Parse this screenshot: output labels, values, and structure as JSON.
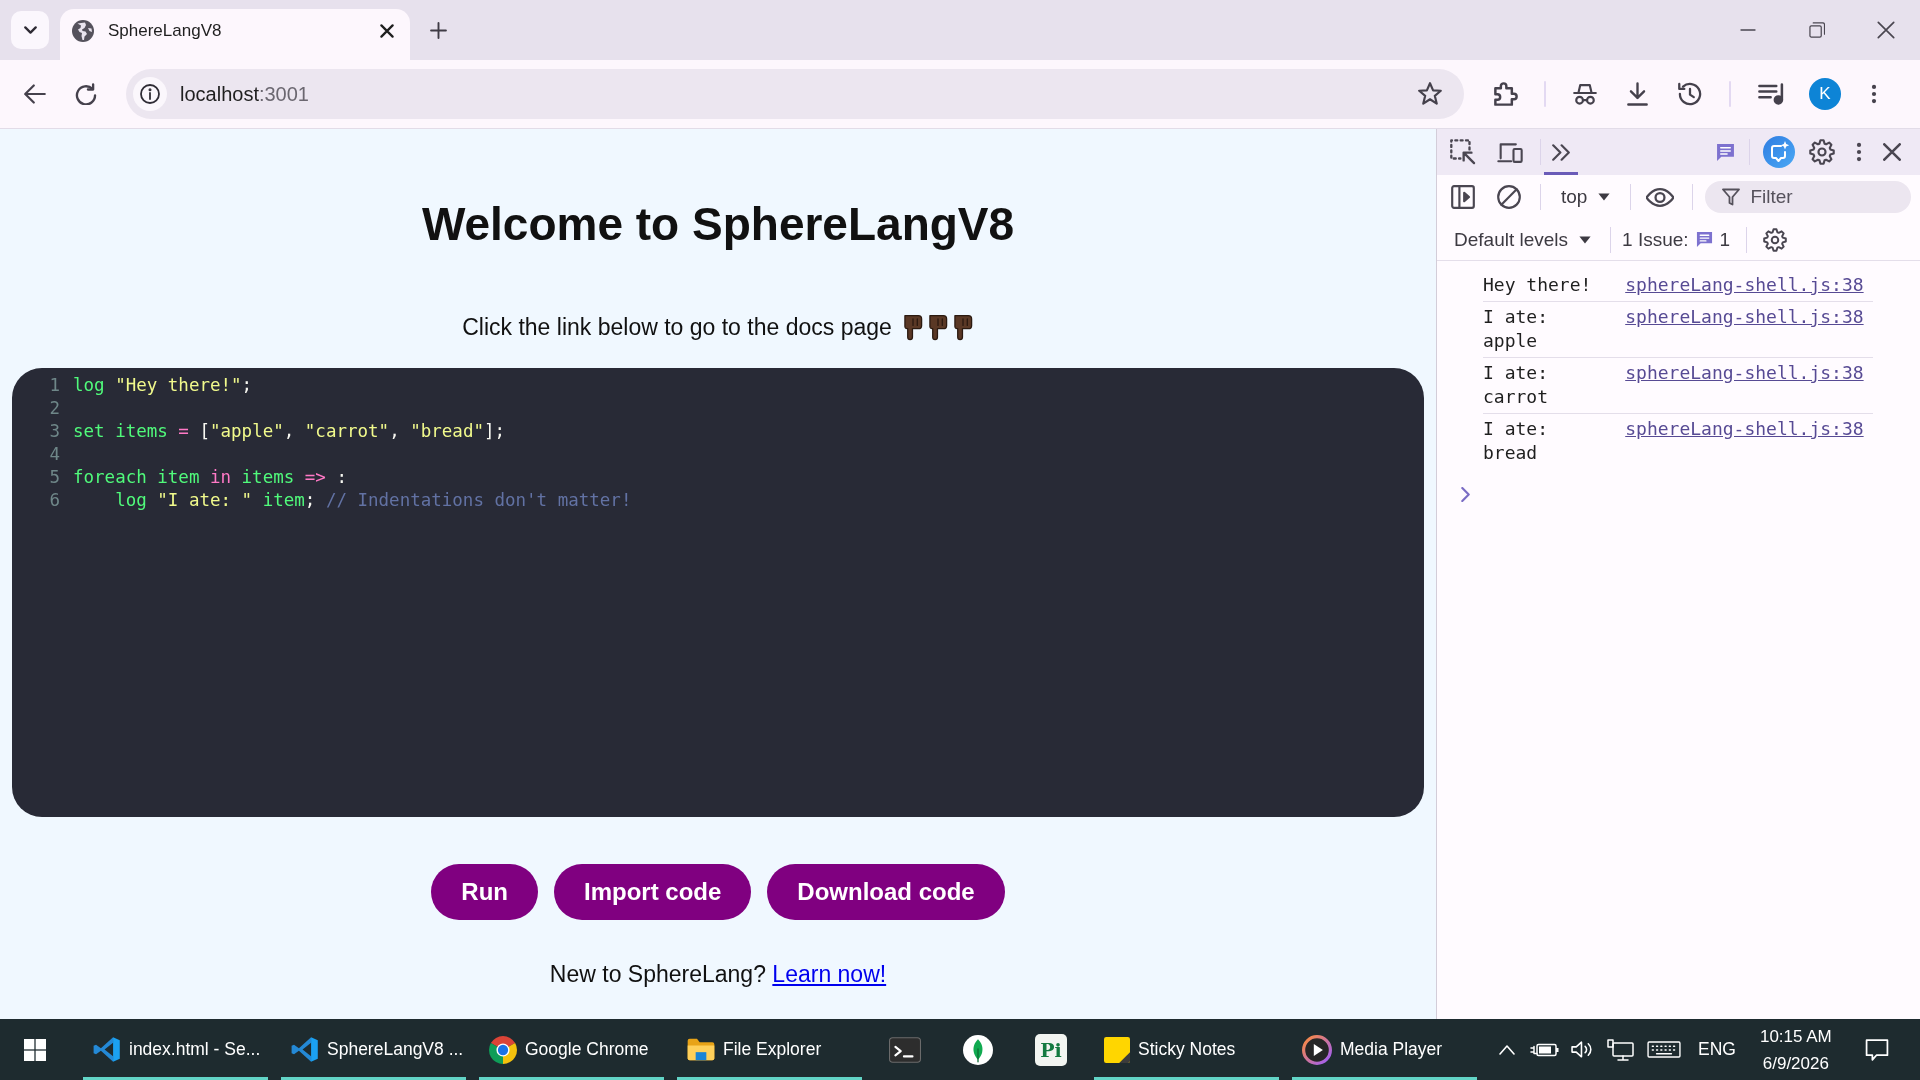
{
  "browser": {
    "tab": {
      "title": "SphereLangV8",
      "selected": true
    },
    "address": {
      "host": "localhost",
      "port": ":3001"
    },
    "profile_initial": "K"
  },
  "page": {
    "title": "Welcome to SphereLangV8",
    "subtitle": "Click the link below to go to the docs page",
    "editor": {
      "lines": [
        {
          "number": "1",
          "tokens": [
            {
              "kind": "keyword",
              "text": "log "
            },
            {
              "kind": "string",
              "text": "\"Hey there!\""
            },
            {
              "kind": "plain",
              "text": ";"
            }
          ]
        },
        {
          "number": "2"
        },
        {
          "number": "3",
          "tokens": [
            {
              "kind": "keyword",
              "text": "set items "
            },
            {
              "kind": "operator",
              "text": "= "
            },
            {
              "kind": "plain",
              "text": "["
            },
            {
              "kind": "string",
              "text": "\"apple\""
            },
            {
              "kind": "plain",
              "text": ", "
            },
            {
              "kind": "string",
              "text": "\"carrot\""
            },
            {
              "kind": "plain",
              "text": ", "
            },
            {
              "kind": "string",
              "text": "\"bread\""
            },
            {
              "kind": "plain",
              "text": "];"
            }
          ]
        },
        {
          "number": "4"
        },
        {
          "number": "5",
          "tokens": [
            {
              "kind": "keyword",
              "text": "foreach item "
            },
            {
              "kind": "operator",
              "text": "in "
            },
            {
              "kind": "keyword",
              "text": "items "
            },
            {
              "kind": "operator",
              "text": "=> "
            },
            {
              "kind": "plain",
              "text": ":"
            }
          ]
        },
        {
          "number": "6",
          "tokens": [
            {
              "kind": "keyword",
              "text": "    log "
            },
            {
              "kind": "string",
              "text": "\"I ate: \""
            },
            {
              "kind": "keyword",
              "text": " item"
            },
            {
              "kind": "plain",
              "text": "; "
            },
            {
              "kind": "comment",
              "text": "// Indentations don't matter!"
            }
          ]
        }
      ]
    },
    "buttons": [
      {
        "label": "Run"
      },
      {
        "label": "Import code"
      },
      {
        "label": "Download code"
      }
    ],
    "footer": {
      "text": "New to SphereLang?",
      "link": "Learn now!"
    }
  },
  "devtools": {
    "more_tabs": {
      "selected": true
    },
    "console": {
      "context": "top",
      "filter": {
        "placeholder": "Filter"
      },
      "levels": "Default levels",
      "issues": {
        "label": "1 Issue:",
        "count": "1"
      },
      "messages": [
        {
          "text": "Hey there!",
          "source": "sphereLang-shell.js:38"
        },
        {
          "text": "I ate: apple",
          "source": "sphereLang-shell.js:38"
        },
        {
          "text": "I ate: carrot",
          "source": "sphereLang-shell.js:38"
        },
        {
          "text": "I ate: bread",
          "source": "sphereLang-shell.js:38"
        }
      ]
    }
  },
  "taskbar": {
    "items": [
      {
        "kind": "app",
        "label": "index.html - Se...",
        "running": true
      },
      {
        "kind": "app",
        "label": "SphereLangV8 ...",
        "running": true
      },
      {
        "kind": "app",
        "label": "Google Chrome",
        "running": true
      },
      {
        "kind": "app",
        "label": "File Explorer",
        "running": true
      },
      {
        "kind": "icon",
        "running": false
      },
      {
        "kind": "icon",
        "running": false
      },
      {
        "kind": "tile",
        "text": "Pi",
        "running": false
      },
      {
        "kind": "app",
        "label": "Sticky Notes",
        "running": true
      },
      {
        "kind": "app",
        "label": "Media Player",
        "running": true
      }
    ],
    "tray": {
      "language": "ENG",
      "time": "10:15 AM",
      "date": "6/9/2026"
    }
  }
}
